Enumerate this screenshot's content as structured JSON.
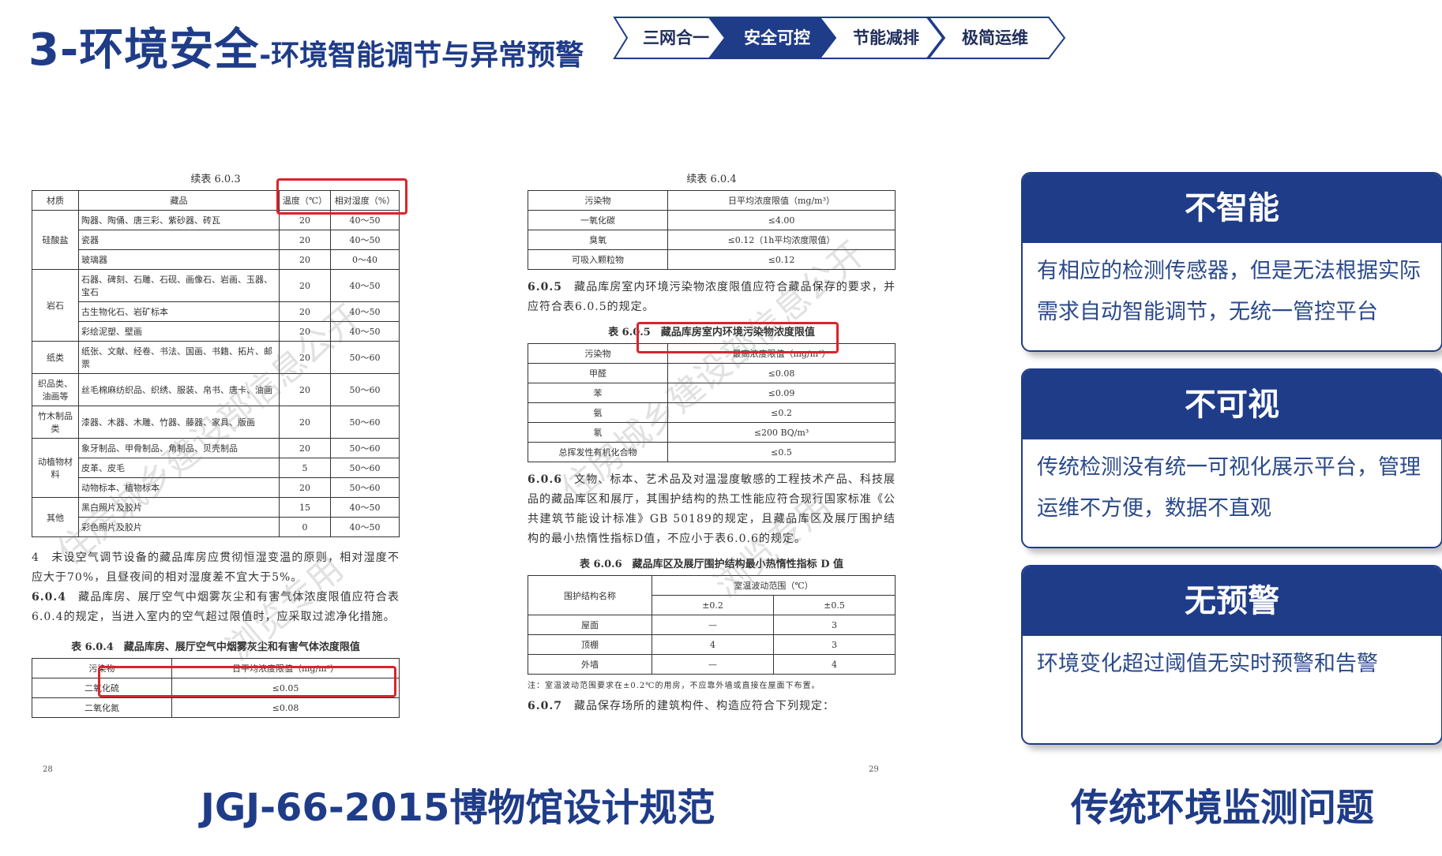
{
  "header": {
    "title_main": "3-环境安全",
    "title_sub": "-环境智能调节与异常预警",
    "steps": [
      {
        "label": "三网合一",
        "active": false
      },
      {
        "label": "安全可控",
        "active": true
      },
      {
        "label": "节能减排",
        "active": false
      },
      {
        "label": "极简运维",
        "active": false
      }
    ]
  },
  "left_doc": {
    "table_caption": "续表 6.0.3",
    "headers": [
      "材质",
      "藏品",
      "温度（℃）",
      "相对湿度（%）"
    ],
    "groups": [
      {
        "material": "硅酸盐",
        "rows": [
          [
            "陶器、陶俑、唐三彩、紫砂器、砖瓦",
            "20",
            "40～50"
          ],
          [
            "瓷器",
            "20",
            "40～50"
          ],
          [
            "玻璃器",
            "20",
            "0～40"
          ]
        ]
      },
      {
        "material": "岩石",
        "rows": [
          [
            "石器、碑刻、石雕、石砚、画像石、岩画、玉器、宝石",
            "20",
            "40～50"
          ],
          [
            "古生物化石、岩矿标本",
            "20",
            "40～50"
          ],
          [
            "彩绘泥塑、壁画",
            "20",
            "40～50"
          ]
        ]
      },
      {
        "material": "纸类",
        "rows": [
          [
            "纸张、文献、经卷、书法、国画、书籍、拓片、邮票",
            "20",
            "50～60"
          ]
        ]
      },
      {
        "material": "织品类、油画等",
        "rows": [
          [
            "丝毛棉麻纺织品、织绣、服装、帛书、唐卡、油画",
            "20",
            "50～60"
          ]
        ]
      },
      {
        "material": "竹木制品类",
        "rows": [
          [
            "漆器、木器、木雕、竹器、藤器、家具、版画",
            "20",
            "50～60"
          ]
        ]
      },
      {
        "material": "动植物材料",
        "rows": [
          [
            "象牙制品、甲骨制品、角制品、贝壳制品",
            "20",
            "50～60"
          ],
          [
            "皮革、皮毛",
            "5",
            "50～60"
          ],
          [
            "动物标本、植物标本",
            "20",
            "50～60"
          ]
        ]
      },
      {
        "material": "其他",
        "rows": [
          [
            "黑白照片及胶片",
            "15",
            "40～50"
          ],
          [
            "彩色照片及胶片",
            "0",
            "40～50"
          ]
        ]
      }
    ],
    "para1": "4　未设空气调节设备的藏品库房应贯彻恒湿变温的原则，相对湿度不应大于70%，且昼夜间的相对湿度差不宜大于5%。",
    "para2_num": "6.0.4",
    "para2": "　藏品库房、展厅空气中烟雾灰尘和有害气体浓度限值应符合表6.0.4的规定，当进入室内的空气超过限值时，应采取过滤净化措施。",
    "table2_caption": "表 6.0.4　藏品库房、展厅空气中烟雾灰尘和有害气体浓度限值",
    "table2_headers": [
      "污染物",
      "日平均浓度限值（mg/m³）"
    ],
    "table2_rows": [
      [
        "二氧化硫",
        "≤0.05"
      ],
      [
        "二氧化氮",
        "≤0.08"
      ]
    ],
    "page_no": "28",
    "watermark1": "住房城乡建设部信息公开",
    "watermark2": "浏览专用"
  },
  "right_doc": {
    "table_caption": "续表 6.0.4",
    "headers": [
      "污染物",
      "日平均浓度限值（mg/m³）"
    ],
    "rows": [
      [
        "一氧化碳",
        "≤4.00"
      ],
      [
        "臭氧",
        "≤0.12（1h平均浓度限值）"
      ],
      [
        "可吸入颗粒物",
        "≤0.12"
      ]
    ],
    "para1_num": "6.0.5",
    "para1": "　藏品库房室内环境污染物浓度限值应符合藏品保存的要求，并应符合表6.0.5的规定。",
    "table2_caption": "表 6.0.5　藏品库房室内环境污染物浓度限值",
    "table2_headers": [
      "污染物",
      "最高浓度限值（mg/m³）"
    ],
    "table2_rows": [
      [
        "甲醛",
        "≤0.08"
      ],
      [
        "苯",
        "≤0.09"
      ],
      [
        "氨",
        "≤0.2"
      ],
      [
        "氡",
        "≤200 BQ/m³"
      ],
      [
        "总挥发性有机化合物",
        "≤0.5"
      ]
    ],
    "para2_num": "6.0.6",
    "para2": "　文物、标本、艺术品及对温湿度敏感的工程技术产品、科技展品的藏品库区和展厅，其围护结构的热工性能应符合现行国家标准《公共建筑节能设计标准》GB 50189的规定，且藏品库区及展厅围护结构的最小热惰性指标D值，不应小于表6.0.6的规定。",
    "table3_caption": "表 6.0.6　藏品库区及展厅围护结构最小热惰性指标 D 值",
    "table3_col1": "围护结构名称",
    "table3_group": "室温波动范围（℃）",
    "table3_sub": [
      "±0.2",
      "±0.5"
    ],
    "table3_rows": [
      [
        "屋面",
        "—",
        "3"
      ],
      [
        "顶棚",
        "4",
        "3"
      ],
      [
        "外墙",
        "—",
        "4"
      ]
    ],
    "note": "注：室温波动范围要求在±0.2℃的用房，不应靠外墙或直接在屋面下布置。",
    "para3_num": "6.0.7",
    "para3": "　藏品保存场所的建筑构件、构造应符合下列规定：",
    "page_no": "29",
    "watermark1": "住房城乡建设部信息公开",
    "watermark2": "浏览专用"
  },
  "captions": {
    "left": "JGJ-66-2015博物馆设计规范",
    "right": "传统环境监测问题"
  },
  "cards": [
    {
      "title": "不智能",
      "body": "有相应的检测传感器，但是无法根据实际需求自动智能调节，无统一管控平台"
    },
    {
      "title": "不可视",
      "body": "传统检测没有统一可视化展示平台，管理运维不方便，数据不直观"
    },
    {
      "title": "无预警",
      "body": "环境变化超过阈值无实时预警和告警"
    }
  ],
  "colors": {
    "primary": "#1f3c88",
    "highlight_box": "#d9242b"
  }
}
